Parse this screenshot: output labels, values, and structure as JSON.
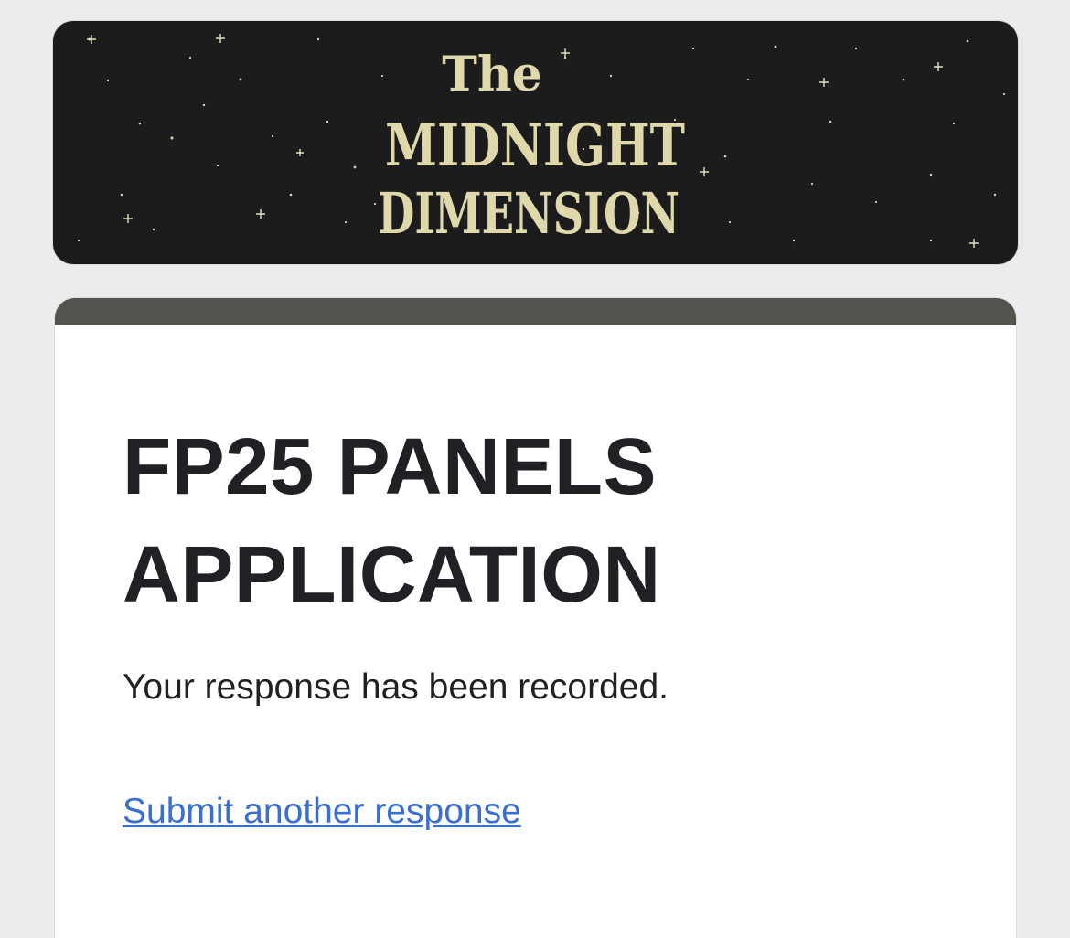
{
  "banner": {
    "logo_line1": "The",
    "logo_line2": "MIDNIGHT",
    "logo_line3": "DIMENSION",
    "logo_color": "#ded8aa",
    "background_color": "#1c1c1c"
  },
  "form": {
    "title_line1": "FP25 PANELS",
    "title_line2": "APPLICATION",
    "confirmation_message": "Your response has been recorded.",
    "submit_another_link": "Submit another response",
    "accent_color": "#52534c",
    "link_color": "#3a6fcf"
  }
}
